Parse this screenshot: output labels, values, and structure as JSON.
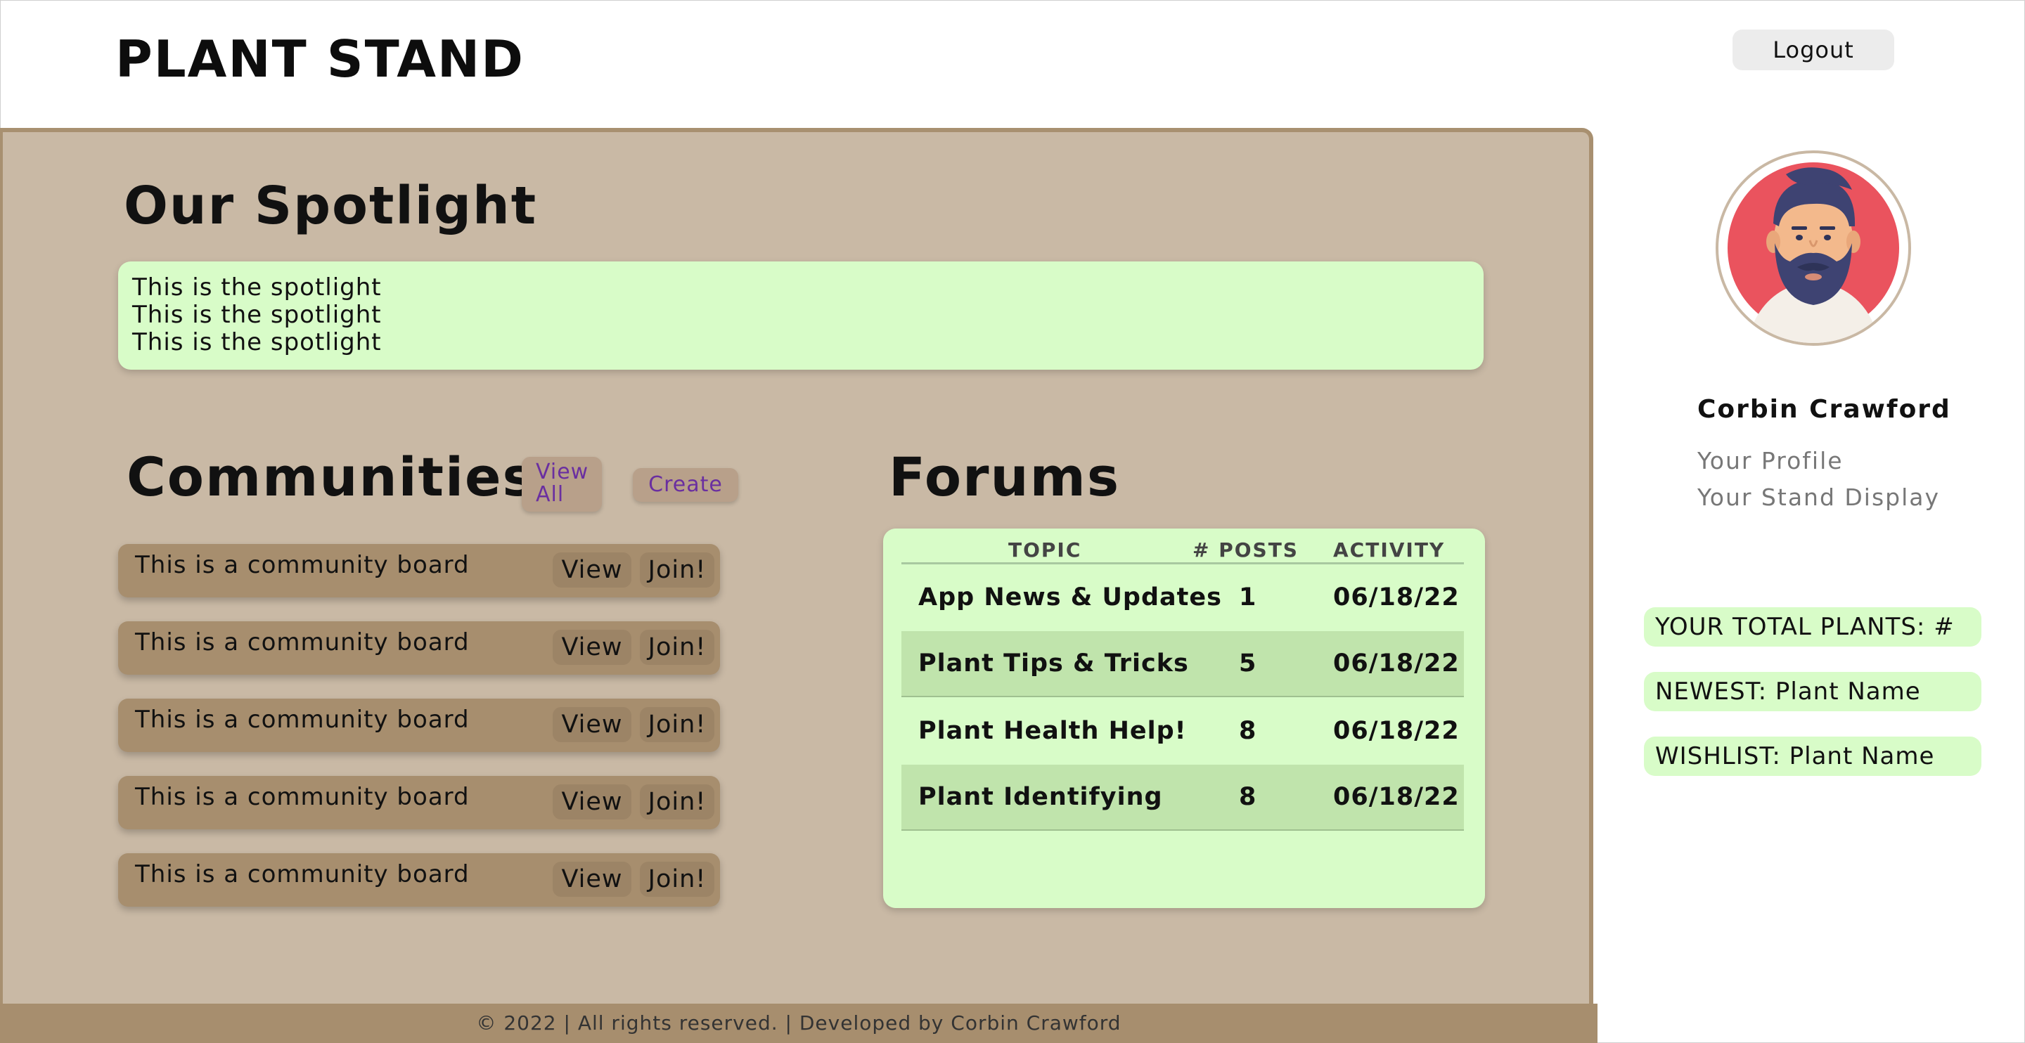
{
  "header": {
    "brand": "PLANT STAND",
    "logout_label": "Logout"
  },
  "spotlight": {
    "title": "Our Spotlight",
    "lines": [
      "This is the spotlight",
      "This is the spotlight",
      "This is the spotlight"
    ]
  },
  "communities": {
    "title": "Communities",
    "view_all_line1": "View",
    "view_all_line2": "All",
    "create_label": "Create",
    "boards": [
      {
        "label": "This is a community board",
        "view": "View",
        "join": "Join!"
      },
      {
        "label": "This is a community board",
        "view": "View",
        "join": "Join!"
      },
      {
        "label": "This is a community board",
        "view": "View",
        "join": "Join!"
      },
      {
        "label": "This is a community board",
        "view": "View",
        "join": "Join!"
      },
      {
        "label": "This is a community board",
        "view": "View",
        "join": "Join!"
      }
    ]
  },
  "forums": {
    "title": "Forums",
    "columns": [
      "TOPIC",
      "# POSTS",
      "ACTIVITY"
    ],
    "rows": [
      {
        "topic": "App News & Updates",
        "posts": "1",
        "activity": "06/18/22"
      },
      {
        "topic": "Plant Tips & Tricks",
        "posts": "5",
        "activity": "06/18/22"
      },
      {
        "topic": "Plant Health Help!",
        "posts": "8",
        "activity": "06/18/22"
      },
      {
        "topic": "Plant Identifying",
        "posts": "8",
        "activity": "06/18/22"
      }
    ]
  },
  "sidebar": {
    "user_name": "Corbin Crawford",
    "links": [
      "Your Profile",
      "Your Stand Display"
    ],
    "stats": [
      "YOUR TOTAL PLANTS: #",
      "NEWEST: Plant Name",
      "WISHLIST: Plant Name"
    ]
  },
  "footer": {
    "text": "© 2022 | All rights reserved. | Developed by Corbin Crawford"
  },
  "colors": {
    "panel": "#c9b9a5",
    "panel_border": "#a89070",
    "card_green": "#d8fcc8",
    "board": "#a78e6e",
    "link_purple": "#6a2fa0"
  }
}
